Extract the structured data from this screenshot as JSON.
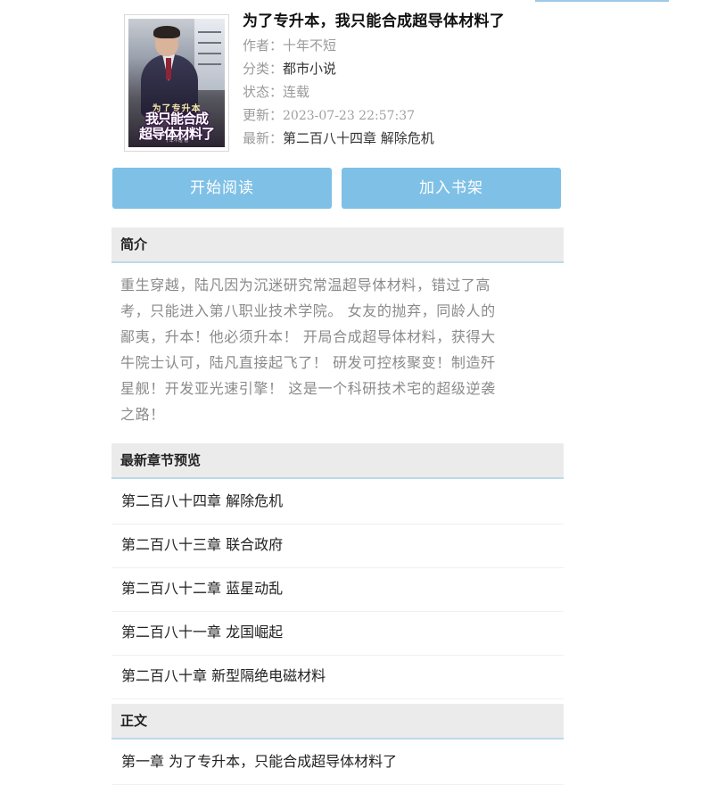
{
  "book": {
    "title": "为了专升本，我只能合成超导体材料了",
    "cover": {
      "small_title": "为了专升本",
      "big_title_line1": "我只能合成",
      "big_title_line2": "超导体材料了",
      "author_tag": "十年不短 著"
    },
    "author_label": "作者：",
    "author": "十年不短",
    "category_label": "分类：",
    "category": "都市小说",
    "status_label": "状态：",
    "status": "连载",
    "updated_label": "更新：",
    "updated": "2023-07-23 22:57:37",
    "latest_label": "最新：",
    "latest": "第二百八十四章 解除危机"
  },
  "buttons": {
    "start_reading": "开始阅读",
    "add_to_shelf": "加入书架"
  },
  "intro": {
    "header": "简介",
    "lines": [
      "重生穿越，陆凡因为沉迷研究常温超导体材料，错过了高",
      "考，只能进入第八职业技术学院。 女友的抛弃，同龄人的",
      "鄙夷，升本！他必须升本！ 开局合成超导体材料，获得大",
      "牛院士认可，陆凡直接起飞了！ 研发可控核聚变！制造歼",
      "星舰！开发亚光速引擎！ 这是一个科研技术宅的超级逆袭",
      "之路！"
    ]
  },
  "latest_chapters": {
    "header": "最新章节预览",
    "items": [
      "第二百八十四章 解除危机",
      "第二百八十三章 联合政府",
      "第二百八十二章 蓝星动乱",
      "第二百八十一章 龙国崛起",
      "第二百八十章 新型隔绝电磁材料"
    ]
  },
  "text_chapters": {
    "header": "正文",
    "items": [
      "第一章 为了专升本，只能合成超导体材料了"
    ]
  },
  "colors": {
    "button_bg": "#7fc0e6",
    "section_header_bg": "#ebebeb",
    "section_underline": "#bcd9ea"
  }
}
